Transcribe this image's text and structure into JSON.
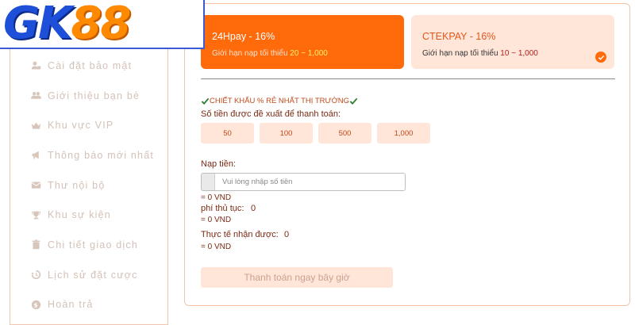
{
  "logo": {
    "left": "GK",
    "right": "88"
  },
  "sidebar": {
    "items": [
      {
        "label": "Cài đặt bảo mật",
        "icon": "user-lock-icon"
      },
      {
        "label": "Giới thiệu bạn bè",
        "icon": "users-icon"
      },
      {
        "label": "Khu vực VIP",
        "icon": "crown-icon"
      },
      {
        "label": "Thông báo mới nhất",
        "icon": "megaphone-icon"
      },
      {
        "label": "Thư nội bộ",
        "icon": "envelope-icon"
      },
      {
        "label": "Khu sự kiện",
        "icon": "trophy-icon"
      },
      {
        "label": "Chi tiết giao dịch",
        "icon": "trash-icon"
      },
      {
        "label": "Lịch sử đặt cược",
        "icon": "history-icon"
      },
      {
        "label": "Hoàn trả",
        "icon": "coin-icon"
      }
    ]
  },
  "payment_methods": [
    {
      "title": "24Hpay - 16%",
      "limit_label": "Giới hạn nạp tối thiểu",
      "limit_range": "20 ~ 1,000"
    },
    {
      "title": "CTEKPAY - 16%",
      "limit_label": "Giới hạn nạp tối thiểu",
      "limit_range": "10 ~ 1,000"
    }
  ],
  "promo": "CHIẾT KHẤU % RẺ NHẤT THỊ TRƯỜNG",
  "suggest_label": "Số tiền được đề xuất để thanh toán:",
  "suggested_amounts": [
    "50",
    "100",
    "500",
    "1,000"
  ],
  "deposit_label": "Nạp tiền:",
  "deposit_placeholder": "Vui lòng nhập số tiền",
  "deposit_vnd": "= 0 VND",
  "fee": {
    "label": "phí thủ tục:",
    "value": "0",
    "vnd": "= 0 VND"
  },
  "received": {
    "label": "Thực tế nhận được:",
    "value": "0",
    "vnd": "= 0 VND"
  },
  "pay_button": "Thanh toán ngay bây giờ",
  "colors": {
    "accent": "#ff6a0a",
    "accent_light": "#ffe6d8",
    "highlight": "#fff06a",
    "check_green": "#2e7d32"
  }
}
